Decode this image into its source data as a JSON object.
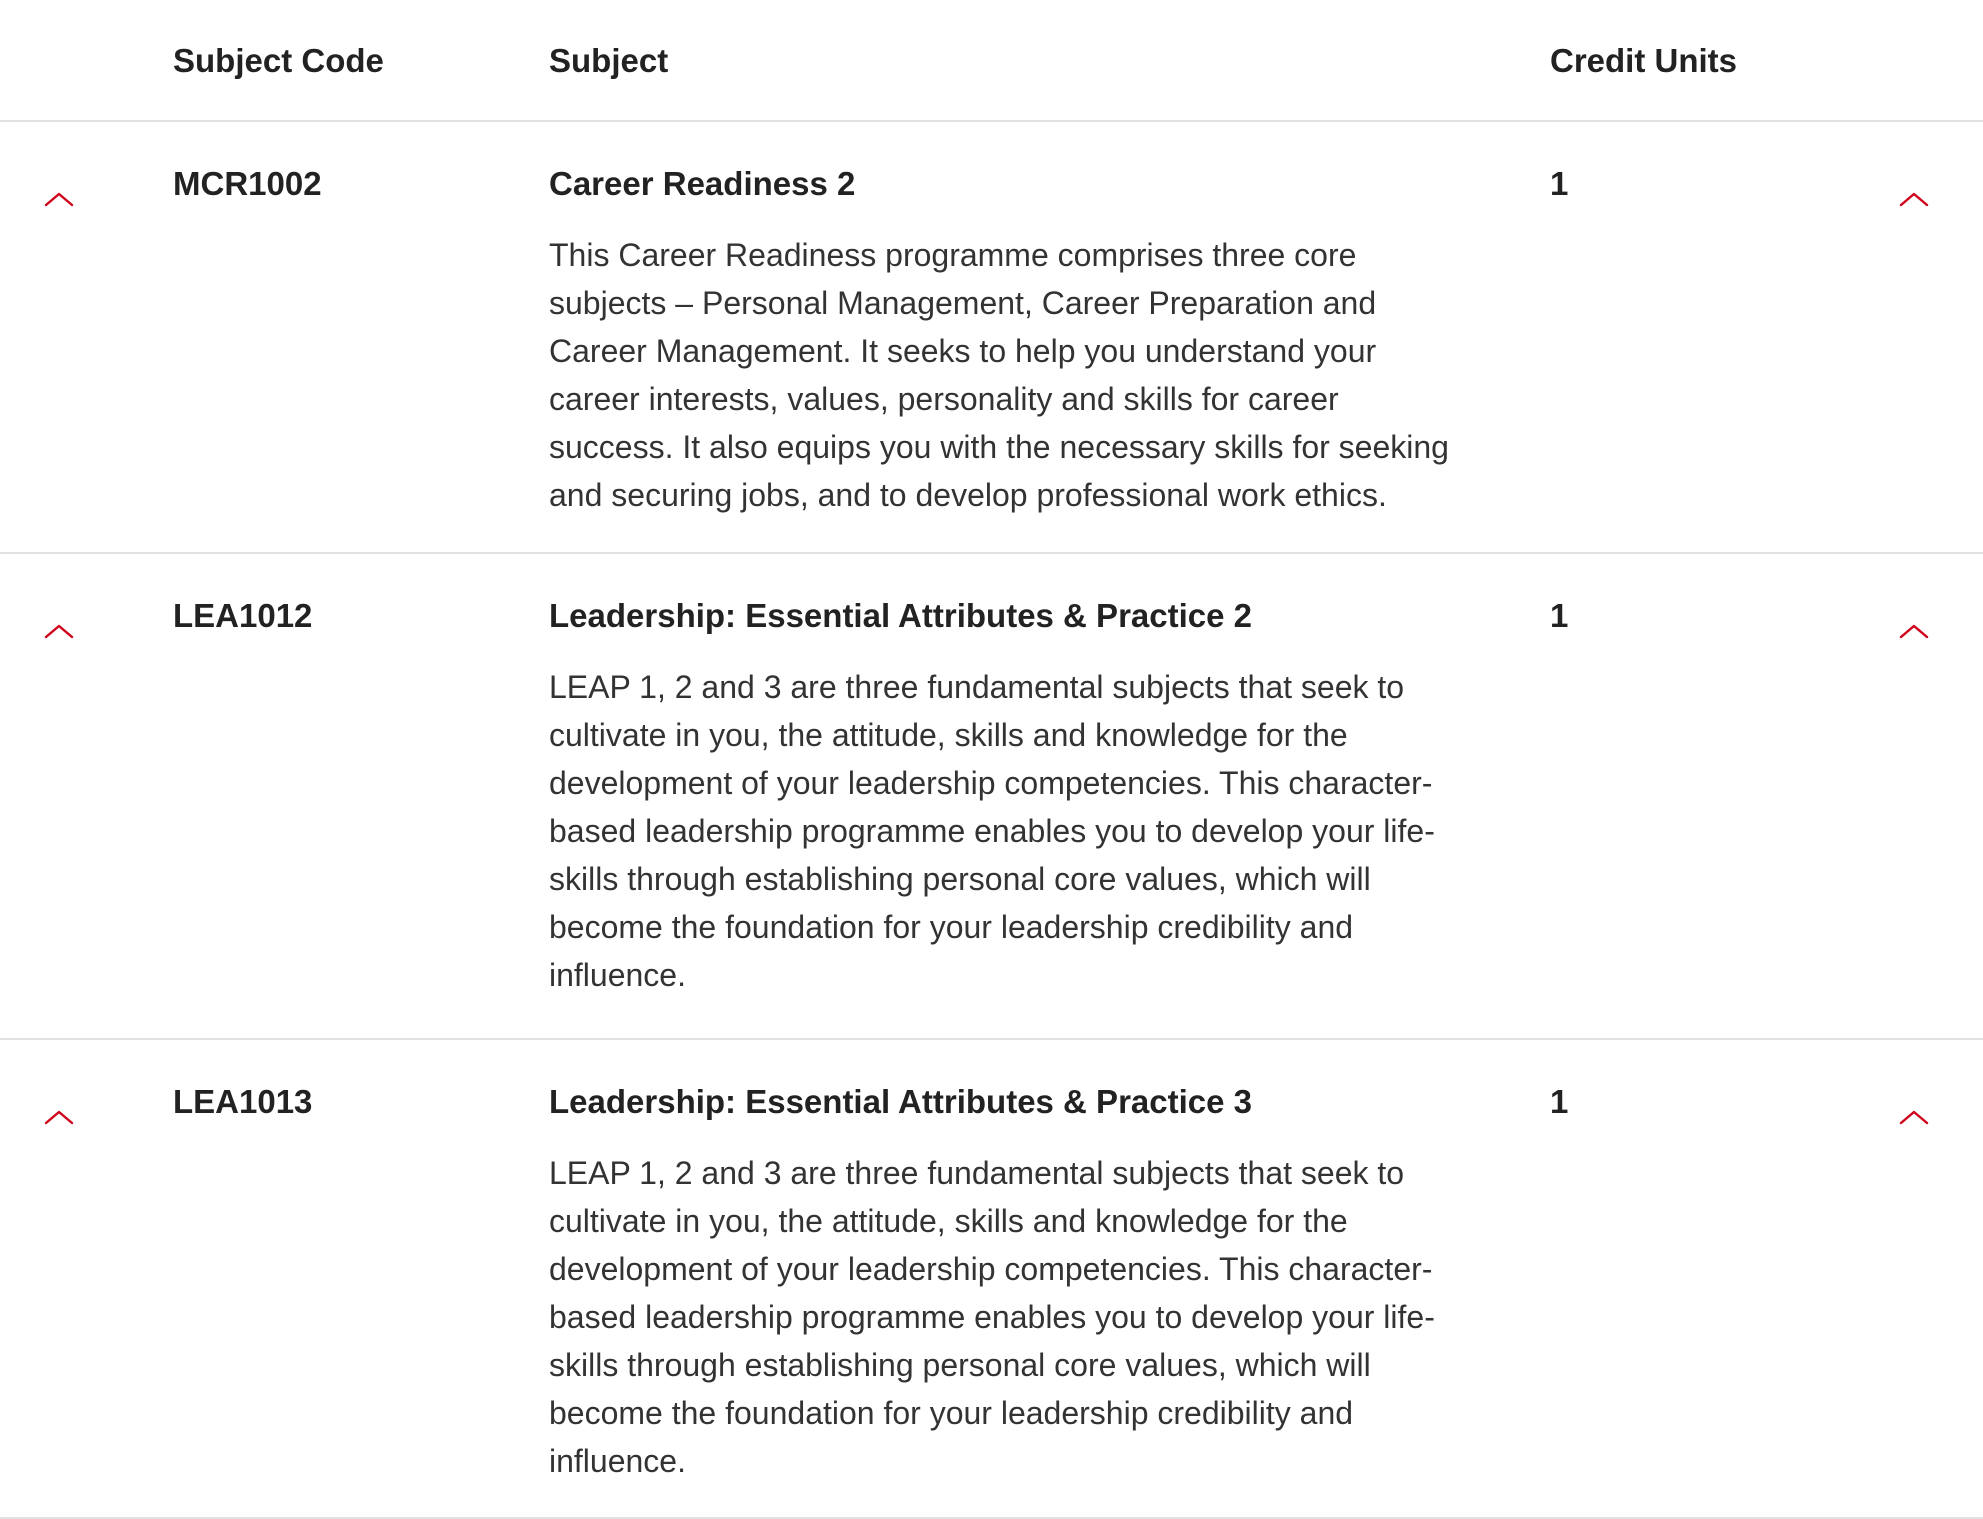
{
  "colors": {
    "accent": "#d0021b",
    "text": "#222222",
    "divider": "#e2e2e2"
  },
  "header": {
    "subject_code": "Subject Code",
    "subject": "Subject",
    "credit_units": "Credit Units"
  },
  "rows": [
    {
      "code": "MCR1002",
      "title": "Career Readiness 2",
      "credits": "1",
      "description": "This Career Readiness programme comprises three core subjects – Personal Management, Career Preparation and Career Management. It seeks to help you understand your career interests, values, personality and skills for career success. It also equips you with the necessary skills for seeking and securing jobs, and to develop professional work ethics.",
      "icon": "chevron-up-icon"
    },
    {
      "code": "LEA1012",
      "title": "Leadership: Essential Attributes & Practice 2",
      "credits": "1",
      "description": "LEAP 1, 2 and 3 are three fundamental subjects that seek to cultivate in you, the attitude, skills and knowledge for the development of your leadership competencies. This character-based leadership programme enables you to develop your life-skills through establishing personal core values, which will become the foundation for your leadership credibility and influence.",
      "icon": "chevron-up-icon"
    },
    {
      "code": "LEA1013",
      "title": "Leadership: Essential Attributes & Practice 3",
      "credits": "1",
      "description": "LEAP 1, 2 and 3 are three fundamental subjects that seek to cultivate in you, the attitude, skills and knowledge for the development of your leadership competencies. This character-based leadership programme enables you to develop your life-skills through establishing personal core values, which will become the foundation for your leadership credibility and influence.",
      "icon": "chevron-up-icon"
    }
  ]
}
